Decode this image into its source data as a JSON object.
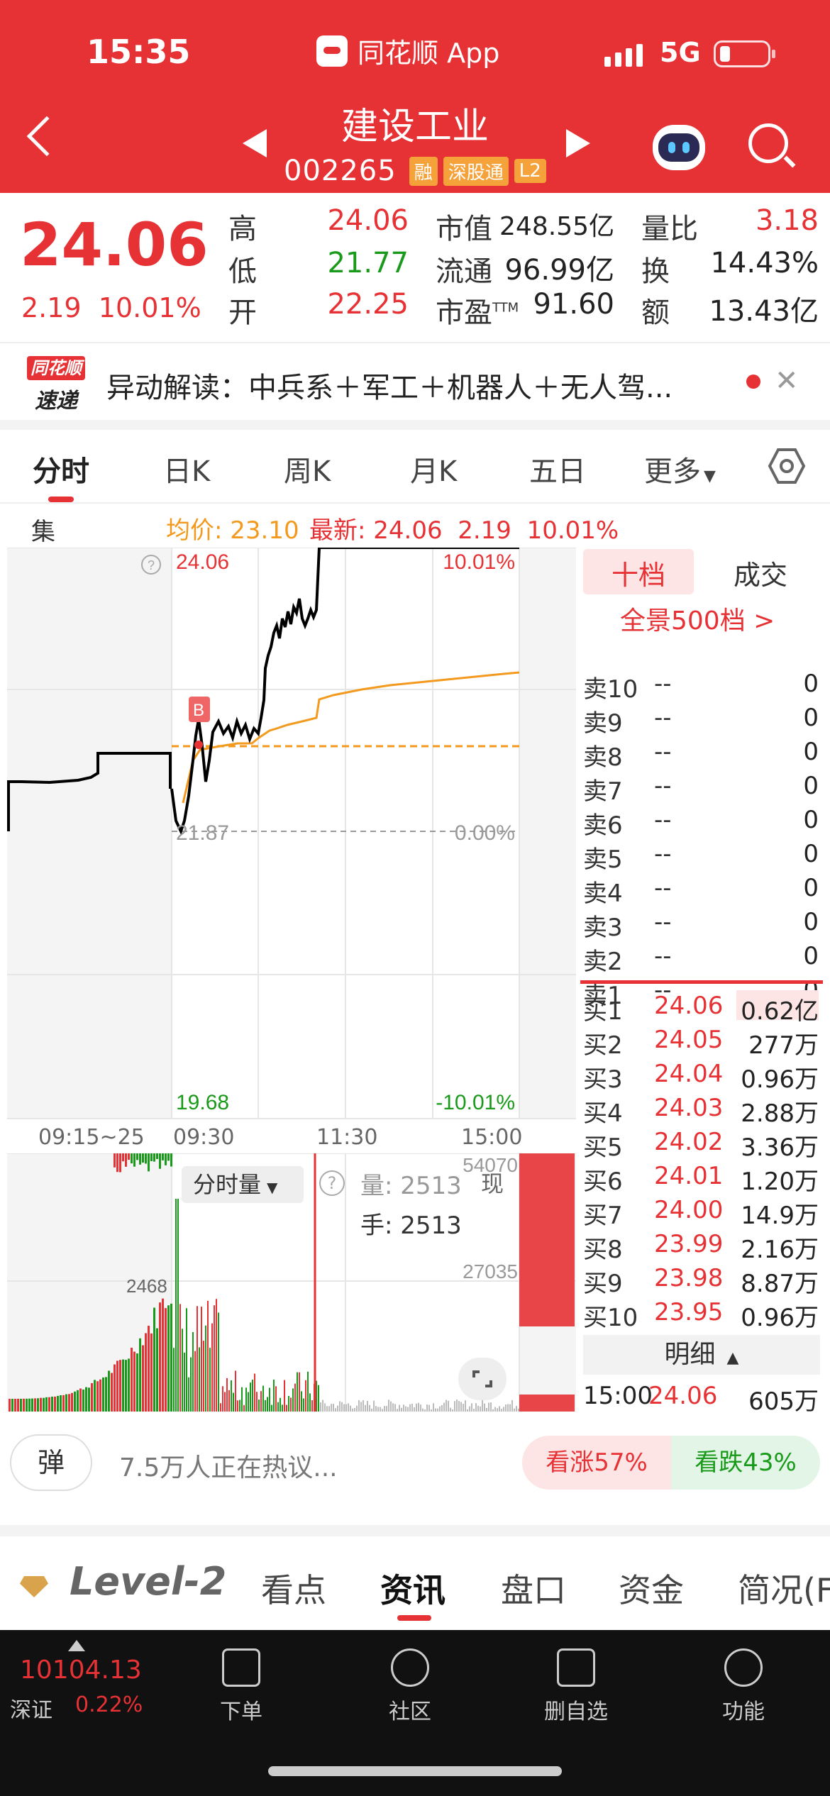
{
  "status_bar": {
    "time": "15:35",
    "app_name": "同花顺 App",
    "network": "5G"
  },
  "header": {
    "stock_name": "建设工业",
    "stock_code": "002265",
    "tags": [
      "融",
      "深股通",
      "L2"
    ]
  },
  "quote": {
    "price": "24.06",
    "change": "2.19",
    "change_pct": "10.01%",
    "high_label": "高",
    "high": "24.06",
    "low_label": "低",
    "low": "21.77",
    "open_label": "开",
    "open": "22.25",
    "mktcap_label": "市值",
    "mktcap": "248.55亿",
    "float_label": "流通",
    "float": "96.99亿",
    "pe_label": "市盈",
    "pe_sup": "TTM",
    "pe": "91.60",
    "vr_label": "量比",
    "vr": "3.18",
    "turnover_label": "换",
    "turnover": "14.43%",
    "amount_label": "额",
    "amount": "13.43亿"
  },
  "news": {
    "badge_top": "同花顺",
    "badge_bottom": "速递",
    "text": "异动解读：中兵系＋军工＋机器人＋无人驾..."
  },
  "tabs": [
    "分时",
    "日K",
    "周K",
    "月K",
    "五日",
    "更多"
  ],
  "subheader": {
    "auction": "集合竞价",
    "avg_label": "均价: 23.10",
    "latest_label": "最新: 24.06",
    "latest_chg": "2.19",
    "latest_pct": "10.01%"
  },
  "chart": {
    "y_top": "24.06",
    "y_mid": "21.87",
    "y_bottom": "19.68",
    "pct_top": "10.01%",
    "pct_mid": "0.00%",
    "pct_bottom": "-10.01%",
    "times": [
      "09:15~25",
      "09:30",
      "11:30",
      "15:00"
    ],
    "marker": "B",
    "vol_label": "分时量",
    "vol_num_label": "量: 2513",
    "hand_label": "手: 2513",
    "vol_max": "54070",
    "vol_mid": "27035",
    "auction_vol": "2468",
    "now_label": "现"
  },
  "order_book": {
    "tab_active": "十档",
    "tab_other": "成交",
    "depth_link": "全景500档 >",
    "asks": [
      {
        "label": "卖10",
        "price": "--",
        "vol": "0"
      },
      {
        "label": "卖9",
        "price": "--",
        "vol": "0"
      },
      {
        "label": "卖8",
        "price": "--",
        "vol": "0"
      },
      {
        "label": "卖7",
        "price": "--",
        "vol": "0"
      },
      {
        "label": "卖6",
        "price": "--",
        "vol": "0"
      },
      {
        "label": "卖5",
        "price": "--",
        "vol": "0"
      },
      {
        "label": "卖4",
        "price": "--",
        "vol": "0"
      },
      {
        "label": "卖3",
        "price": "--",
        "vol": "0"
      },
      {
        "label": "卖2",
        "price": "--",
        "vol": "0"
      },
      {
        "label": "卖1",
        "price": "--",
        "vol": "0"
      }
    ],
    "bids": [
      {
        "label": "买1",
        "price": "24.06",
        "vol": "0.62亿"
      },
      {
        "label": "买2",
        "price": "24.05",
        "vol": "277万"
      },
      {
        "label": "买3",
        "price": "24.04",
        "vol": "0.96万"
      },
      {
        "label": "买4",
        "price": "24.03",
        "vol": "2.88万"
      },
      {
        "label": "买5",
        "price": "24.02",
        "vol": "3.36万"
      },
      {
        "label": "买6",
        "price": "24.01",
        "vol": "1.20万"
      },
      {
        "label": "买7",
        "price": "24.00",
        "vol": "14.9万"
      },
      {
        "label": "买8",
        "price": "23.99",
        "vol": "2.16万"
      },
      {
        "label": "买9",
        "price": "23.98",
        "vol": "8.87万"
      },
      {
        "label": "买10",
        "price": "23.95",
        "vol": "0.96万"
      }
    ],
    "detail_label": "明细",
    "last_trade": {
      "time": "15:00",
      "price": "24.06",
      "vol": "605万"
    }
  },
  "comments": {
    "danmu": "弹",
    "hot_text": "7.5万人正在热议...",
    "bull": "看涨57%",
    "bear": "看跌43%"
  },
  "bottom_tabs": [
    "Level-2",
    "看点",
    "资讯",
    "盘口",
    "资金",
    "简况(F"
  ],
  "footer": {
    "index_value": "10104.13",
    "index_name": "深证",
    "index_pct": "0.22%",
    "buttons": [
      "下单",
      "社区",
      "删自选",
      "功能"
    ]
  },
  "colors": {
    "brand_red": "#e63235",
    "down_green": "#1a9a1a",
    "avg_line": "#f39a1e"
  }
}
